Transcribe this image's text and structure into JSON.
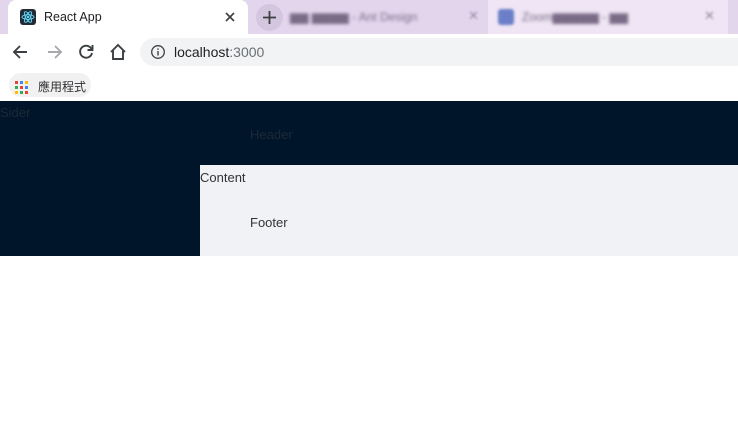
{
  "browser": {
    "active_tab": {
      "title": "React App",
      "icon": "react-icon"
    },
    "background_tabs": [
      {
        "title": "...",
        "icon": "antd-icon"
      },
      {
        "title": "...",
        "icon": "zoom-icon"
      }
    ],
    "address": {
      "host": "localhost",
      "port": ":3000"
    },
    "bookmarks": {
      "apps_label": "應用程式"
    }
  },
  "page": {
    "sider": "Sider",
    "header": "Header",
    "content": "Content",
    "footer": "Footer"
  },
  "colors": {
    "layout_dark": "#001529",
    "content_bg": "#f0f2f5"
  }
}
